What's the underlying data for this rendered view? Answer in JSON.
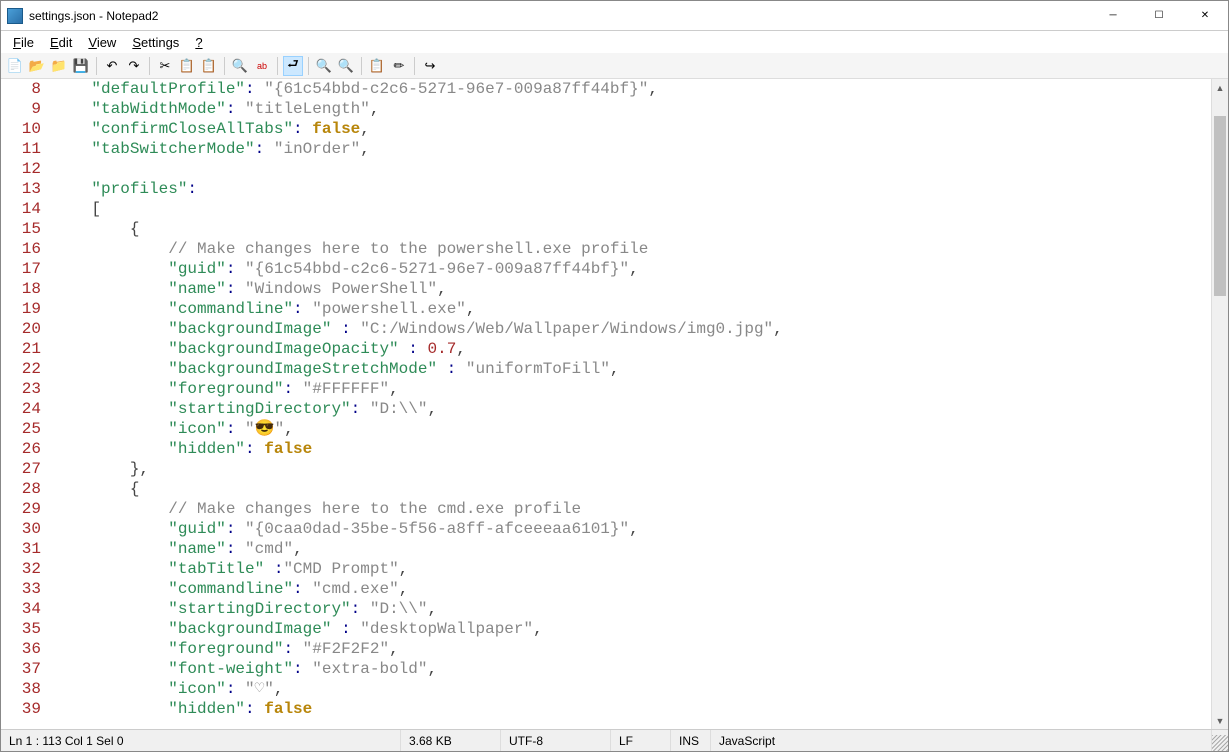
{
  "title": "settings.json - Notepad2",
  "menu": [
    "File",
    "Edit",
    "View",
    "Settings",
    "?"
  ],
  "toolbar_icons": [
    "new",
    "open",
    "browse",
    "save",
    "undo",
    "redo",
    "cut",
    "copy",
    "paste",
    "find",
    "replace",
    "wordwrap",
    "zoomin",
    "zoomout",
    "scheme",
    "customize",
    "exit"
  ],
  "status": {
    "pos": "Ln 1 : 113  Col 1  Sel 0",
    "size": "3.68 KB",
    "encoding": "UTF-8",
    "eol": "LF",
    "ovr": "INS",
    "lexer": "JavaScript"
  },
  "lines": [
    {
      "n": 8,
      "indent": 4,
      "tokens": [
        [
          "key",
          "\"defaultProfile\""
        ],
        [
          "op",
          ":"
        ],
        [
          "sp",
          " "
        ],
        [
          "str",
          "\"{61c54bbd-c2c6-5271-96e7-009a87ff44bf}\""
        ],
        [
          "punct",
          ","
        ]
      ]
    },
    {
      "n": 9,
      "indent": 4,
      "tokens": [
        [
          "key",
          "\"tabWidthMode\""
        ],
        [
          "op",
          ":"
        ],
        [
          "sp",
          " "
        ],
        [
          "str",
          "\"titleLength\""
        ],
        [
          "punct",
          ","
        ]
      ]
    },
    {
      "n": 10,
      "indent": 4,
      "tokens": [
        [
          "key",
          "\"confirmCloseAllTabs\""
        ],
        [
          "op",
          ":"
        ],
        [
          "sp",
          " "
        ],
        [
          "bool",
          "false"
        ],
        [
          "punct",
          ","
        ]
      ]
    },
    {
      "n": 11,
      "indent": 4,
      "tokens": [
        [
          "key",
          "\"tabSwitcherMode\""
        ],
        [
          "op",
          ":"
        ],
        [
          "sp",
          " "
        ],
        [
          "str",
          "\"inOrder\""
        ],
        [
          "punct",
          ","
        ]
      ]
    },
    {
      "n": 12,
      "indent": 0,
      "tokens": []
    },
    {
      "n": 13,
      "indent": 4,
      "tokens": [
        [
          "key",
          "\"profiles\""
        ],
        [
          "op",
          ":"
        ]
      ]
    },
    {
      "n": 14,
      "indent": 4,
      "tokens": [
        [
          "punct",
          "["
        ]
      ]
    },
    {
      "n": 15,
      "indent": 8,
      "tokens": [
        [
          "punct",
          "{"
        ]
      ]
    },
    {
      "n": 16,
      "indent": 12,
      "tokens": [
        [
          "comment",
          "// Make changes here to the powershell.exe profile"
        ]
      ]
    },
    {
      "n": 17,
      "indent": 12,
      "tokens": [
        [
          "key",
          "\"guid\""
        ],
        [
          "op",
          ":"
        ],
        [
          "sp",
          " "
        ],
        [
          "str",
          "\"{61c54bbd-c2c6-5271-96e7-009a87ff44bf}\""
        ],
        [
          "punct",
          ","
        ]
      ]
    },
    {
      "n": 18,
      "indent": 12,
      "tokens": [
        [
          "key",
          "\"name\""
        ],
        [
          "op",
          ":"
        ],
        [
          "sp",
          " "
        ],
        [
          "str",
          "\"Windows PowerShell\""
        ],
        [
          "punct",
          ","
        ]
      ]
    },
    {
      "n": 19,
      "indent": 12,
      "tokens": [
        [
          "key",
          "\"commandline\""
        ],
        [
          "op",
          ":"
        ],
        [
          "sp",
          " "
        ],
        [
          "str",
          "\"powershell.exe\""
        ],
        [
          "punct",
          ","
        ]
      ]
    },
    {
      "n": 20,
      "indent": 12,
      "tokens": [
        [
          "key",
          "\"backgroundImage\""
        ],
        [
          "sp",
          " "
        ],
        [
          "op",
          ":"
        ],
        [
          "sp",
          " "
        ],
        [
          "str",
          "\"C:/Windows/Web/Wallpaper/Windows/img0.jpg\""
        ],
        [
          "punct",
          ","
        ]
      ]
    },
    {
      "n": 21,
      "indent": 12,
      "tokens": [
        [
          "key",
          "\"backgroundImageOpacity\""
        ],
        [
          "sp",
          " "
        ],
        [
          "op",
          ":"
        ],
        [
          "sp",
          " "
        ],
        [
          "num",
          "0.7"
        ],
        [
          "punct",
          ","
        ]
      ]
    },
    {
      "n": 22,
      "indent": 12,
      "tokens": [
        [
          "key",
          "\"backgroundImageStretchMode\""
        ],
        [
          "sp",
          " "
        ],
        [
          "op",
          ":"
        ],
        [
          "sp",
          " "
        ],
        [
          "str",
          "\"uniformToFill\""
        ],
        [
          "punct",
          ","
        ]
      ]
    },
    {
      "n": 23,
      "indent": 12,
      "tokens": [
        [
          "key",
          "\"foreground\""
        ],
        [
          "op",
          ":"
        ],
        [
          "sp",
          " "
        ],
        [
          "str",
          "\"#FFFFFF\""
        ],
        [
          "punct",
          ","
        ]
      ]
    },
    {
      "n": 24,
      "indent": 12,
      "tokens": [
        [
          "key",
          "\"startingDirectory\""
        ],
        [
          "op",
          ":"
        ],
        [
          "sp",
          " "
        ],
        [
          "str",
          "\"D:\\\\\""
        ],
        [
          "punct",
          ","
        ]
      ]
    },
    {
      "n": 25,
      "indent": 12,
      "tokens": [
        [
          "key",
          "\"icon\""
        ],
        [
          "op",
          ":"
        ],
        [
          "sp",
          " "
        ],
        [
          "str",
          "\"😎\""
        ],
        [
          "punct",
          ","
        ]
      ]
    },
    {
      "n": 26,
      "indent": 12,
      "tokens": [
        [
          "key",
          "\"hidden\""
        ],
        [
          "op",
          ":"
        ],
        [
          "sp",
          " "
        ],
        [
          "bool",
          "false"
        ]
      ]
    },
    {
      "n": 27,
      "indent": 8,
      "tokens": [
        [
          "punct",
          "},"
        ]
      ]
    },
    {
      "n": 28,
      "indent": 8,
      "tokens": [
        [
          "punct",
          "{"
        ]
      ]
    },
    {
      "n": 29,
      "indent": 12,
      "tokens": [
        [
          "comment",
          "// Make changes here to the cmd.exe profile"
        ]
      ]
    },
    {
      "n": 30,
      "indent": 12,
      "tokens": [
        [
          "key",
          "\"guid\""
        ],
        [
          "op",
          ":"
        ],
        [
          "sp",
          " "
        ],
        [
          "str",
          "\"{0caa0dad-35be-5f56-a8ff-afceeeaa6101}\""
        ],
        [
          "punct",
          ","
        ]
      ]
    },
    {
      "n": 31,
      "indent": 12,
      "tokens": [
        [
          "key",
          "\"name\""
        ],
        [
          "op",
          ":"
        ],
        [
          "sp",
          " "
        ],
        [
          "str",
          "\"cmd\""
        ],
        [
          "punct",
          ","
        ]
      ]
    },
    {
      "n": 32,
      "indent": 12,
      "tokens": [
        [
          "key",
          "\"tabTitle\""
        ],
        [
          "sp",
          " "
        ],
        [
          "op",
          ":"
        ],
        [
          "str",
          "\"CMD Prompt\""
        ],
        [
          "punct",
          ","
        ]
      ]
    },
    {
      "n": 33,
      "indent": 12,
      "tokens": [
        [
          "key",
          "\"commandline\""
        ],
        [
          "op",
          ":"
        ],
        [
          "sp",
          " "
        ],
        [
          "str",
          "\"cmd.exe\""
        ],
        [
          "punct",
          ","
        ]
      ]
    },
    {
      "n": 34,
      "indent": 12,
      "tokens": [
        [
          "key",
          "\"startingDirectory\""
        ],
        [
          "op",
          ":"
        ],
        [
          "sp",
          " "
        ],
        [
          "str",
          "\"D:\\\\\""
        ],
        [
          "punct",
          ","
        ]
      ]
    },
    {
      "n": 35,
      "indent": 12,
      "tokens": [
        [
          "key",
          "\"backgroundImage\""
        ],
        [
          "sp",
          " "
        ],
        [
          "op",
          ":"
        ],
        [
          "sp",
          " "
        ],
        [
          "str",
          "\"desktopWallpaper\""
        ],
        [
          "punct",
          ","
        ]
      ]
    },
    {
      "n": 36,
      "indent": 12,
      "tokens": [
        [
          "key",
          "\"foreground\""
        ],
        [
          "op",
          ":"
        ],
        [
          "sp",
          " "
        ],
        [
          "str",
          "\"#F2F2F2\""
        ],
        [
          "punct",
          ","
        ]
      ]
    },
    {
      "n": 37,
      "indent": 12,
      "tokens": [
        [
          "key",
          "\"font-weight\""
        ],
        [
          "op",
          ":"
        ],
        [
          "sp",
          " "
        ],
        [
          "str",
          "\"extra-bold\""
        ],
        [
          "punct",
          ","
        ]
      ]
    },
    {
      "n": 38,
      "indent": 12,
      "tokens": [
        [
          "key",
          "\"icon\""
        ],
        [
          "op",
          ":"
        ],
        [
          "sp",
          " "
        ],
        [
          "str",
          "\"♡\""
        ],
        [
          "punct",
          ","
        ]
      ]
    },
    {
      "n": 39,
      "indent": 12,
      "tokens": [
        [
          "key",
          "\"hidden\""
        ],
        [
          "op",
          ":"
        ],
        [
          "sp",
          " "
        ],
        [
          "bool",
          "false"
        ]
      ]
    }
  ]
}
